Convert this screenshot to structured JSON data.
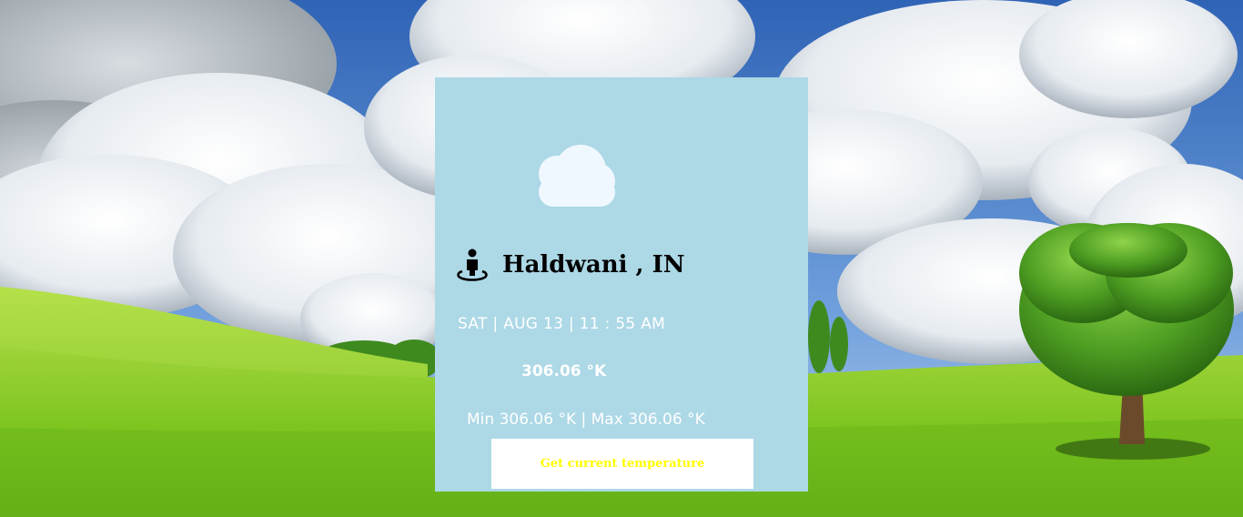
{
  "card": {
    "background": "#add8e6",
    "weather_icon": "cloud-icon",
    "location_icon": "person-location-icon",
    "location": "Haldwani , IN",
    "datetime": "SAT | AUG 13 | 11 : 55 AM",
    "temperature": "306.06 °K",
    "min_max": "Min 306.06 °K | Max 306.06 °K"
  },
  "button": {
    "label": "Get current temperature",
    "text_color": "#ffff00",
    "background": "#ffffff"
  }
}
